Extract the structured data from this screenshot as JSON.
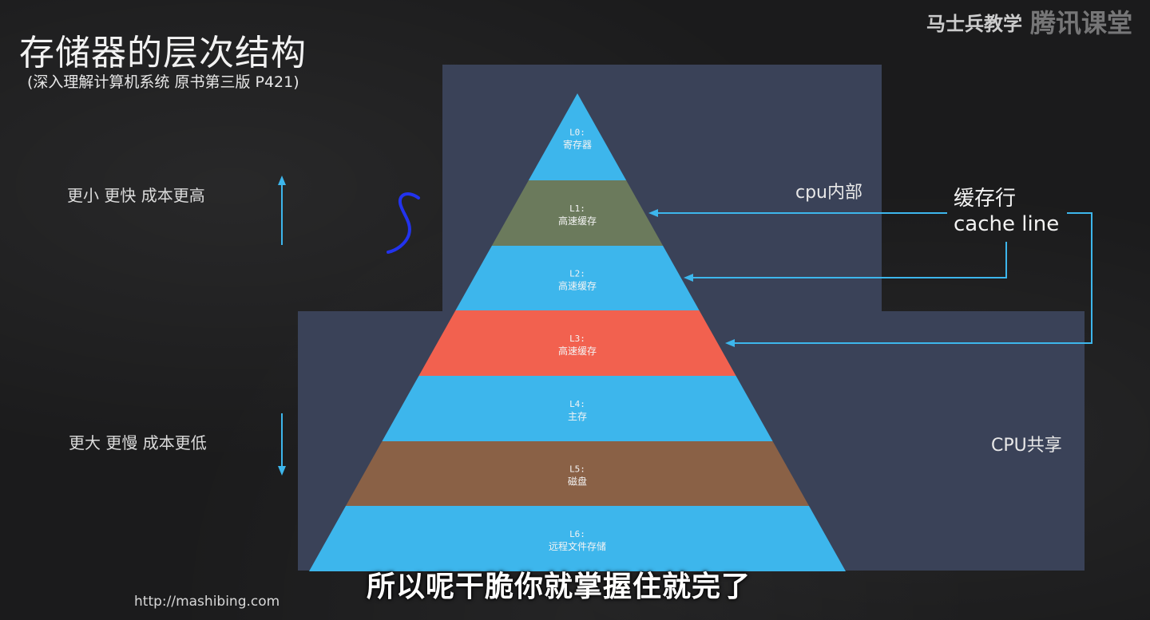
{
  "header": {
    "title": "存储器的层次结构",
    "subtitle": "(深入理解计算机系统 原书第三版 P421)"
  },
  "watermark": {
    "left": "马士兵教学",
    "right": "腾讯课堂"
  },
  "side_labels": {
    "top": "更小 更快 成本更高",
    "bottom": "更大 更慢 成本更低"
  },
  "regions": {
    "cpu_inside": "cpu内部",
    "cpu_shared": "CPU共享"
  },
  "cache_line": {
    "line1": "缓存行",
    "line2": "cache line"
  },
  "levels": [
    {
      "id": "L0:",
      "desc": "寄存器",
      "color": "#3db6ec"
    },
    {
      "id": "L1:",
      "desc": "高速缓存",
      "color": "#6b7a5c"
    },
    {
      "id": "L2:",
      "desc": "高速缓存",
      "color": "#3db6ec"
    },
    {
      "id": "L3:",
      "desc": "高速缓存",
      "color": "#f2614f"
    },
    {
      "id": "L4:",
      "desc": "主存",
      "color": "#3db6ec"
    },
    {
      "id": "L5:",
      "desc": "磁盘",
      "color": "#8a6146"
    },
    {
      "id": "L6:",
      "desc": "远程文件存储",
      "color": "#3db6ec"
    }
  ],
  "colors": {
    "box": "#3a4258",
    "arrow": "#3db6ec",
    "side_arrow": "#3db6ec",
    "annotation": "#2233ee"
  },
  "footer": {
    "url": "http://mashibing.com",
    "caption": "所以呢干脆你就掌握住就完了"
  }
}
